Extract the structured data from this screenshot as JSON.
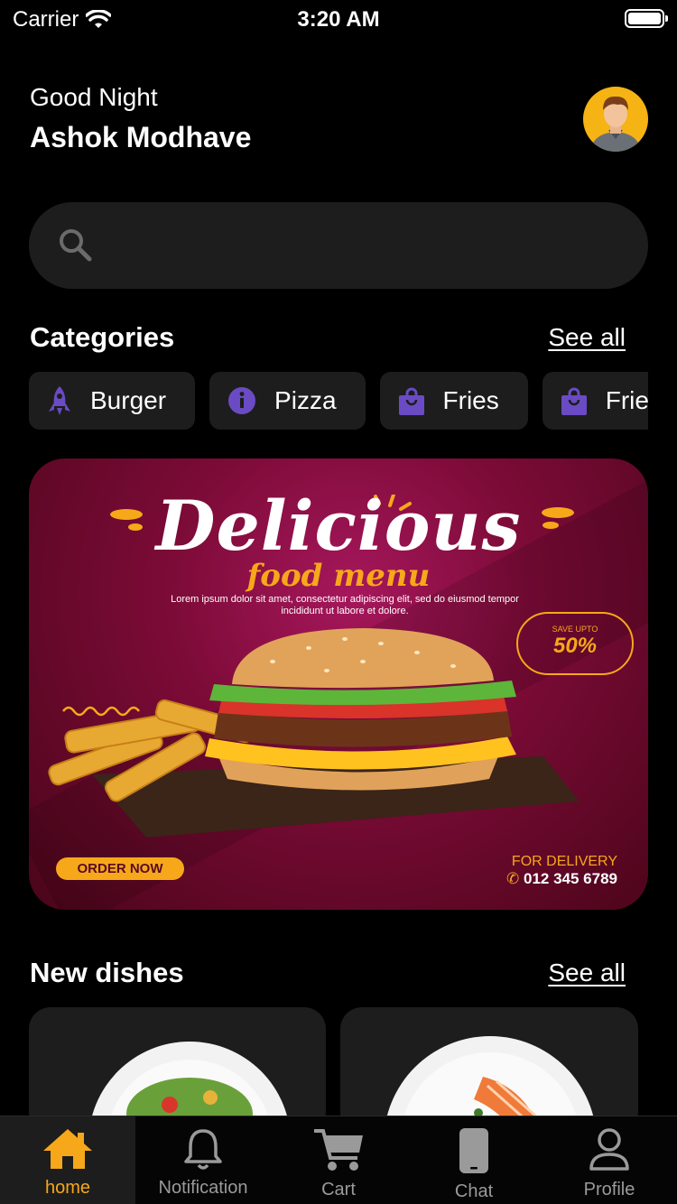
{
  "status_bar": {
    "carrier": "Carrier",
    "time": "3:20 AM"
  },
  "header": {
    "greeting": "Good Night",
    "username": "Ashok Modhave"
  },
  "search": {
    "placeholder": ""
  },
  "categories": {
    "title": "Categories",
    "see_all": "See all",
    "items": [
      {
        "label": "Burger",
        "icon": "rocket-icon"
      },
      {
        "label": "Pizza",
        "icon": "info-icon"
      },
      {
        "label": "Fries",
        "icon": "shopping-bag-icon"
      },
      {
        "label": "Fries",
        "icon": "shopping-bag-icon"
      }
    ]
  },
  "banner": {
    "title": "Delicious",
    "subtitle": "food menu",
    "body": "Lorem ipsum dolor sit amet, consectetur adipiscing elit, sed do eiusmod tempor incididunt ut labore et dolore.",
    "save_label": "SAVE UPTO",
    "save_value": "50%",
    "order_button": "ORDER NOW",
    "delivery_label": "FOR DELIVERY",
    "phone": "012 345 6789"
  },
  "new_dishes": {
    "title": "New dishes",
    "see_all": "See all"
  },
  "tab_bar": {
    "items": [
      {
        "label": "home",
        "icon": "home-icon",
        "active": true
      },
      {
        "label": "Notification",
        "icon": "bell-icon",
        "active": false
      },
      {
        "label": "Cart",
        "icon": "cart-icon",
        "active": false
      },
      {
        "label": "Chat",
        "icon": "phone-icon",
        "active": false
      },
      {
        "label": "Profile",
        "icon": "user-icon",
        "active": false
      }
    ]
  },
  "colors": {
    "accent": "#f6a81a",
    "chip_icon": "#6a4bc4",
    "surface": "#1d1d1d",
    "background": "#000000"
  }
}
